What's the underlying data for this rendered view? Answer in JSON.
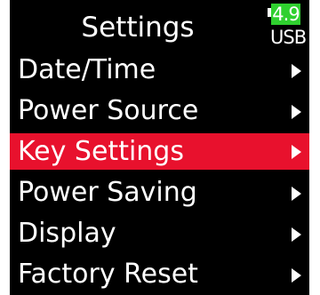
{
  "header": {
    "title": "Settings",
    "battery_level": "4.9",
    "power_source": "USB"
  },
  "menu": {
    "items": [
      {
        "label": "Date/Time",
        "selected": false
      },
      {
        "label": "Power Source",
        "selected": false
      },
      {
        "label": "Key Settings",
        "selected": true
      },
      {
        "label": "Power Saving",
        "selected": false
      },
      {
        "label": "Display",
        "selected": false
      },
      {
        "label": "Factory Reset",
        "selected": false
      }
    ]
  },
  "colors": {
    "background": "#000000",
    "text": "#ffffff",
    "selection": "#e8112d",
    "battery": "#2fd02f"
  },
  "icons": {
    "item_arrow": "chevron-right-icon",
    "battery": "battery-icon"
  }
}
